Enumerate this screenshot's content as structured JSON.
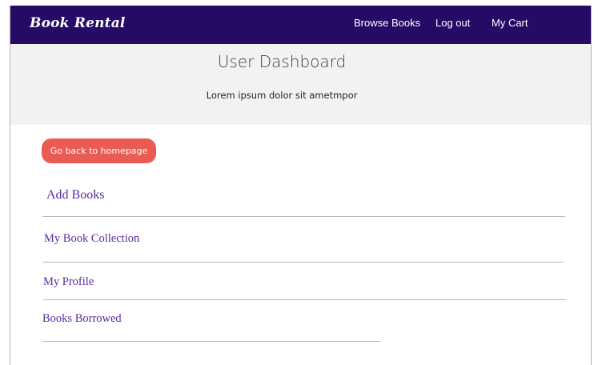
{
  "navbar": {
    "brand": "Book Rental",
    "links": [
      "Browse Books",
      "Log out",
      "My Cart"
    ]
  },
  "header": {
    "title": "User Dashboard",
    "subtitle": "Lorem ipsum dolor sit ametmpor"
  },
  "main": {
    "back_button": "Go back to homepage",
    "menu": [
      "Add Books",
      "My Book Collection",
      "My Profile",
      "Books Borrowed"
    ]
  },
  "colors": {
    "navbar_bg": "#270a66",
    "button_bg": "#ea5b54",
    "link_color": "#5a2aa0",
    "header_bg": "#f2f2f2"
  }
}
